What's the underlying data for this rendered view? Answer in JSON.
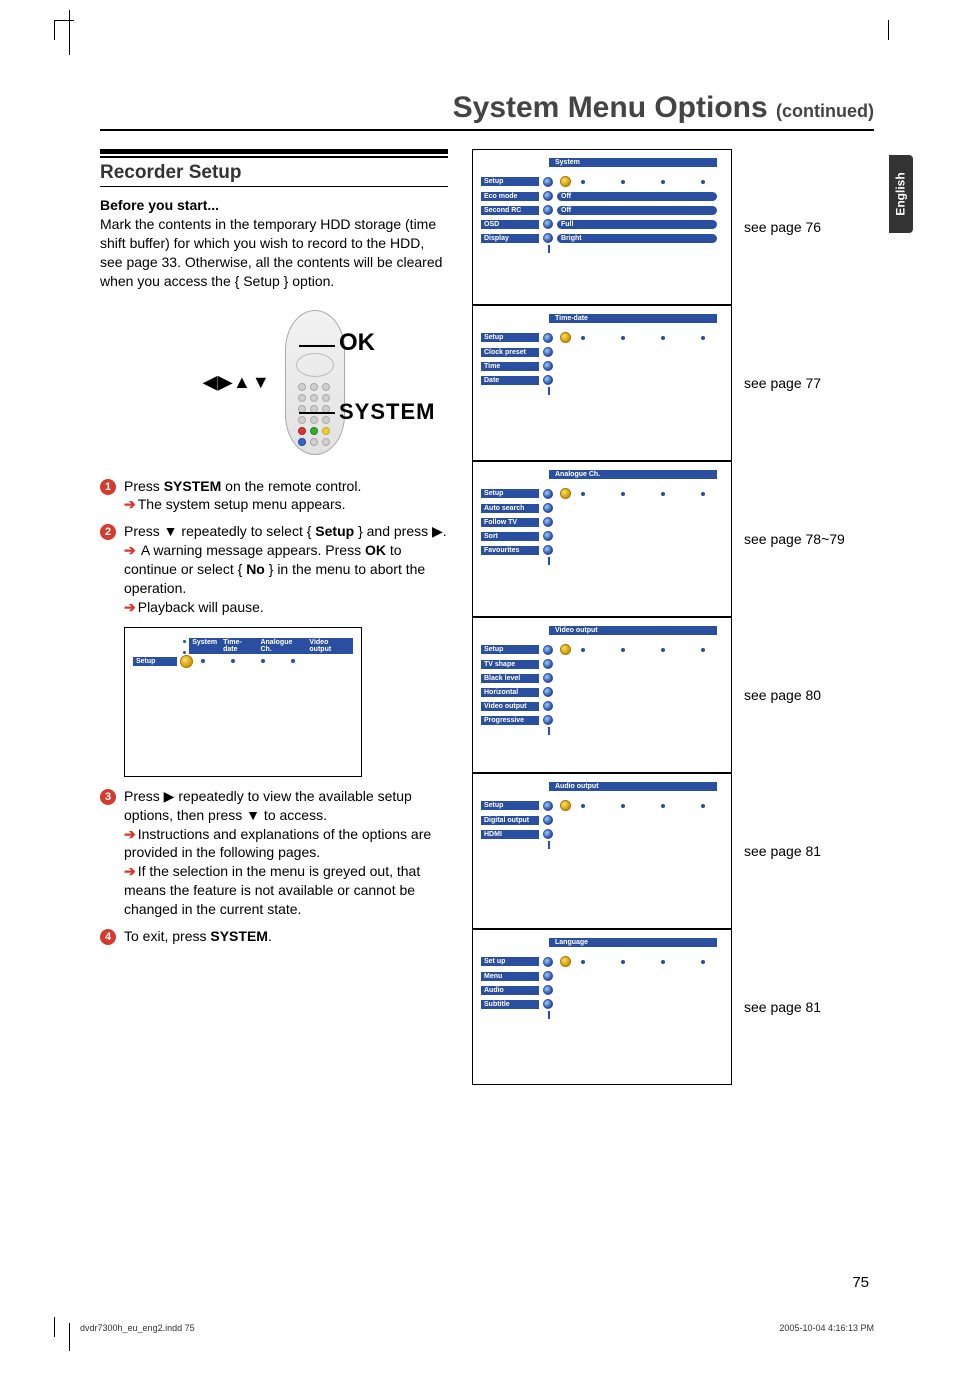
{
  "header": {
    "title": "System Menu Options",
    "continued": "(continued)"
  },
  "language_tab": "English",
  "recorder_setup": {
    "title": "Recorder Setup",
    "before_label": "Before you start...",
    "before_text": "Mark the contents in the temporary HDD storage (time shift buffer) for which you wish to record to the HDD, see page 33. Otherwise, all the contents will be cleared when you access the { Setup } option.",
    "ok_label": "OK",
    "system_label": "SYSTEM",
    "step1_a": "Press ",
    "step1_b": "SYSTEM",
    "step1_c": " on the remote control.",
    "step1_res": "The system setup menu appears.",
    "step2_a": "Press ▼ repeatedly to select { ",
    "step2_b": "Setup",
    "step2_c": " } and press ▶.",
    "step2_res_a": "A warning message appears. Press ",
    "step2_res_b": "OK",
    "step2_res_c": " to continue or select { ",
    "step2_res_d": "No",
    "step2_res_e": " } in the menu to abort the operation.",
    "step2_res2": "Playback will pause.",
    "step3_a": "Press ▶ repeatedly to view the available setup options, then press ▼ to access.",
    "step3_res": "Instructions and explanations of the options are provided in the following pages.",
    "step3_res2": "If the selection in the menu is greyed out, that means the feature is not available or cannot be changed in the current state.",
    "step4_a": "To exit, press ",
    "step4_b": "SYSTEM",
    "step4_c": "."
  },
  "mini": {
    "setup": "Setup",
    "tabs": [
      "System",
      "Time-date",
      "Analogue Ch.",
      "Video output"
    ]
  },
  "cards": [
    {
      "tag": "System",
      "setup": "Setup",
      "rows": [
        {
          "label": "Eco mode",
          "val": "Off"
        },
        {
          "label": "Second RC",
          "val": "Off"
        },
        {
          "label": "OSD",
          "val": "Full"
        },
        {
          "label": "Display",
          "val": "Bright"
        }
      ],
      "ref": "see page 76"
    },
    {
      "tag": "Time-date",
      "setup": "Setup",
      "rows": [
        {
          "label": "Clock preset",
          "val": ""
        },
        {
          "label": "Time",
          "val": ""
        },
        {
          "label": "Date",
          "val": ""
        }
      ],
      "ref": "see page 77"
    },
    {
      "tag": "Analogue Ch.",
      "setup": "Setup",
      "rows": [
        {
          "label": "Auto search",
          "val": ""
        },
        {
          "label": "Follow TV",
          "val": ""
        },
        {
          "label": "Sort",
          "val": ""
        },
        {
          "label": "Favourites",
          "val": ""
        }
      ],
      "ref": "see page 78~79"
    },
    {
      "tag": "Video output",
      "setup": "Setup",
      "rows": [
        {
          "label": "TV shape",
          "val": ""
        },
        {
          "label": "Black level",
          "val": ""
        },
        {
          "label": "Horizontal",
          "val": ""
        },
        {
          "label": "Video output",
          "val": ""
        },
        {
          "label": "Progressive",
          "val": ""
        }
      ],
      "ref": "see page 80"
    },
    {
      "tag": "Audio output",
      "setup": "Setup",
      "rows": [
        {
          "label": "Digital output",
          "val": ""
        },
        {
          "label": "HDMI",
          "val": ""
        }
      ],
      "ref": "see page 81"
    },
    {
      "tag": "Language",
      "setup": "Set up",
      "rows": [
        {
          "label": "Menu",
          "val": ""
        },
        {
          "label": "Audio",
          "val": ""
        },
        {
          "label": "Subtitle",
          "val": ""
        }
      ],
      "ref": "see page 81"
    }
  ],
  "footer": {
    "file": "dvdr7300h_eu_eng2.indd   75",
    "datetime": "2005-10-04   4:16:13 PM",
    "pagenum": "75"
  }
}
